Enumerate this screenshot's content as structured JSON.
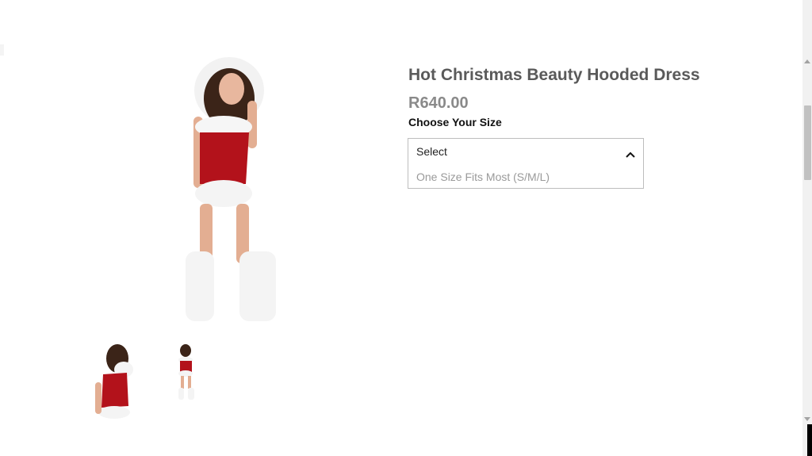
{
  "product": {
    "title": "Hot Christmas Beauty Hooded Dress",
    "price": "R640.00"
  },
  "size_selector": {
    "label": "Choose Your Size",
    "current": "Select",
    "options": [
      "One Size Fits Most (S/M/L)"
    ],
    "expanded": true
  },
  "gallery": {
    "main_image": "product-main-image",
    "thumbnails": [
      "back-view-thumbnail",
      "front-view-thumbnail"
    ]
  },
  "colors": {
    "title": "#5a5a5a",
    "price": "#8a8a8a",
    "dress_red": "#b3121b",
    "fur_white": "#f4f4f4"
  }
}
